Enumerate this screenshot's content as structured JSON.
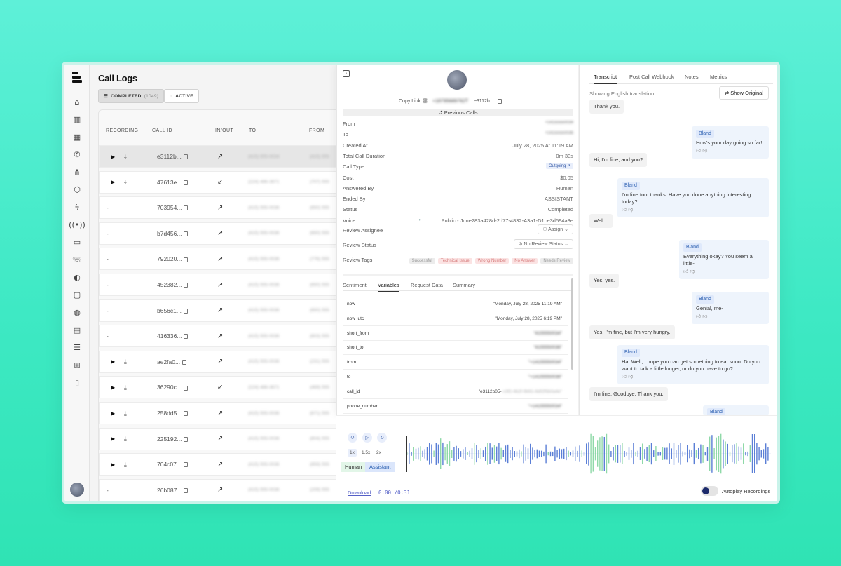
{
  "app": {
    "title": "Call Logs"
  },
  "filters": {
    "completed_label": "COMPLETED",
    "completed_count": "(1049)",
    "active_label": "ACTIVE"
  },
  "table": {
    "headers": {
      "recording": "RECORDING",
      "call_id": "CALL ID",
      "in_out": "IN/OUT",
      "to": "TO",
      "from": "FROM"
    },
    "rows": [
      {
        "rec": true,
        "id": "e3112b...",
        "dir": "↗",
        "to": "(415) 555-0034",
        "from": "(415) 555"
      },
      {
        "rec": true,
        "id": "47613e...",
        "dir": "↙",
        "to": "(224) 486-3671",
        "from": "(707) 555"
      },
      {
        "rec": false,
        "id": "703954...",
        "dir": "↗",
        "to": "(415) 555-0036",
        "from": "(650) 555"
      },
      {
        "rec": false,
        "id": "b7d456...",
        "dir": "↗",
        "to": "(415) 555-0036",
        "from": "(650) 555"
      },
      {
        "rec": false,
        "id": "792020...",
        "dir": "↗",
        "to": "(415) 555-0036",
        "from": "(776) 555"
      },
      {
        "rec": false,
        "id": "452382...",
        "dir": "↗",
        "to": "(415) 555-0036",
        "from": "(650) 555"
      },
      {
        "rec": false,
        "id": "b656c1...",
        "dir": "↗",
        "to": "(415) 555-0036",
        "from": "(650) 555"
      },
      {
        "rec": false,
        "id": "416336...",
        "dir": "↗",
        "to": "(415) 555-0036",
        "from": "(803) 555"
      },
      {
        "rec": true,
        "id": "ae2fa0...",
        "dir": "↗",
        "to": "(415) 555-0036",
        "from": "(231) 555"
      },
      {
        "rec": true,
        "id": "36290c...",
        "dir": "↙",
        "to": "(224) 486-3671",
        "from": "(469) 555"
      },
      {
        "rec": true,
        "id": "258dd5...",
        "dir": "↗",
        "to": "(415) 555-0036",
        "from": "(671) 555"
      },
      {
        "rec": true,
        "id": "225192...",
        "dir": "↗",
        "to": "(415) 555-0036",
        "from": "(804) 555"
      },
      {
        "rec": true,
        "id": "704c07...",
        "dir": "↗",
        "to": "(415) 555-0036",
        "from": "(859) 555"
      },
      {
        "rec": false,
        "id": "26b087...",
        "dir": "↗",
        "to": "(415) 555-0036",
        "from": "(209) 555"
      }
    ]
  },
  "detail": {
    "copy_link": "Copy Link",
    "phone_blur": "+18795689762T",
    "call_short": "e3112b...",
    "previous_calls": "Previous Calls",
    "fields": [
      {
        "k": "From",
        "v": "+14155550034",
        "blur": true
      },
      {
        "k": "To",
        "v": "+14155550036",
        "blur": true
      },
      {
        "k": "Created At",
        "v": "July 28, 2025 At 11:19 AM"
      },
      {
        "k": "Total Call Duration",
        "v": "0m 33s"
      },
      {
        "k": "Call Type",
        "v": "Outgoing ↗",
        "pill": true
      },
      {
        "k": "Cost",
        "v": "$0.05"
      },
      {
        "k": "Answered By",
        "v": "Human"
      },
      {
        "k": "Ended By",
        "v": "ASSISTANT"
      },
      {
        "k": "Status",
        "v": "Completed"
      },
      {
        "k": "Voice",
        "v": "Public - June283a428d-2d77-4832-A3a1-D1ce3d594a8e"
      }
    ],
    "review_assignee": {
      "label": "Review Assignee",
      "button": "Assign"
    },
    "review_status": {
      "label": "Review Status",
      "button": "No Review Status"
    },
    "review_tags": {
      "label": "Review Tags",
      "tags": [
        "Successful",
        "Technical Issue",
        "Wrong Number",
        "No Answer",
        "Needs Review"
      ]
    },
    "tabs": [
      "Sentiment",
      "Variables",
      "Request Data",
      "Summary"
    ],
    "variables": [
      {
        "k": "now",
        "v": "\"Monday, July 28, 2025 11:19 AM\""
      },
      {
        "k": "now_utc",
        "v": "\"Monday, July 28, 2025 6:19 PM\""
      },
      {
        "k": "short_from",
        "v": "\"4155550034\"",
        "blur": true
      },
      {
        "k": "short_to",
        "v": "\"4155550036\"",
        "blur": true
      },
      {
        "k": "from",
        "v": "\"+14155550034\"",
        "blur": true
      },
      {
        "k": "to",
        "v": "\"+14155550036\"",
        "blur": true
      },
      {
        "k": "call_id",
        "v": "\"e3112b05-",
        "tail": "c3f2-4b2f-9b91-8df2f5b0a4e\""
      },
      {
        "k": "phone_number",
        "v": "\"+14155550034\"",
        "blur": true
      }
    ]
  },
  "transcript": {
    "tabs": [
      "Transcript",
      "Post Call Webhook",
      "Notes",
      "Metrics"
    ],
    "showing": "Showing English translation",
    "show_original": "Show Original",
    "messages": [
      {
        "role": "user",
        "text": "Thank you."
      },
      {
        "role": "bot",
        "who": "Bland",
        "text": "How's your day going so far!"
      },
      {
        "role": "user",
        "text": "Hi, I'm fine, and you?"
      },
      {
        "role": "bot",
        "who": "Bland",
        "text": "I'm fine too, thanks. Have you done anything interesting today?"
      },
      {
        "role": "user",
        "text": "Well..."
      },
      {
        "role": "bot",
        "who": "Bland",
        "text": "Everything okay? You seem a little-"
      },
      {
        "role": "user",
        "text": "Yes, yes."
      },
      {
        "role": "bot",
        "who": "Bland",
        "text": "Genial, me-"
      },
      {
        "role": "user",
        "text": "Yes, I'm fine, but I'm very hungry."
      },
      {
        "role": "bot",
        "who": "Bland",
        "text": "Ha! Well, I hope you can get something to eat soon. Do you want to talk a little longer, or do you have to go?"
      },
      {
        "role": "user",
        "text": "I'm fine. Goodbye. Thank you."
      },
      {
        "role": "bot",
        "who": "Bland",
        "text": ""
      }
    ]
  },
  "player": {
    "speeds": [
      "1x",
      "1.5x",
      "2x"
    ],
    "legend": {
      "human": "Human",
      "assistant": "Assistant"
    },
    "download": "Download",
    "time": "0:00 /0:31",
    "autoplay": "Autoplay Recordings",
    "colors": {
      "human": "#8fd9a8",
      "assistant": "#5b7fd6"
    }
  }
}
